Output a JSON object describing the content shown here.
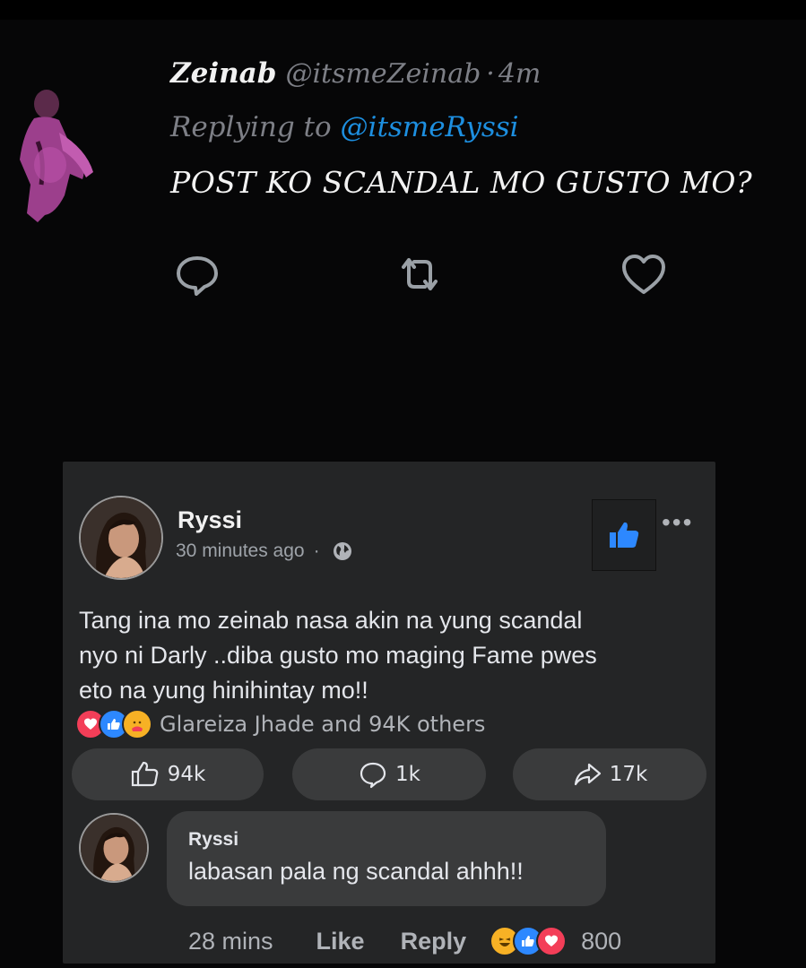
{
  "tweet": {
    "author_name": "Zeinab",
    "author_handle": "@itsmeZeinab",
    "separator": "·",
    "time": "4m",
    "replying_prefix": "Replying to",
    "replying_handle": "@itsmeRyssi",
    "text": "POST KO SCANDAL MO GUSTO MO?",
    "actions": [
      "reply-icon",
      "retweet-icon",
      "like-icon"
    ]
  },
  "post": {
    "author_name": "Ryssi",
    "time": "30 minutes ago",
    "separator": "·",
    "privacy_icon": "globe-icon",
    "more_label": "•••",
    "text_lines": [
      "Tang ina mo zeinab nasa akin na yung scandal",
      "nyo ni Darly ..diba gusto mo maging Fame pwes",
      "eto na yung hinihintay mo!!"
    ],
    "reactions_label": "Glareiza Jhade and 94K others",
    "reaction_icons": [
      "love-icon",
      "like-icon",
      "care-icon"
    ],
    "buttons": {
      "like_count": "94k",
      "comment_count": "1k",
      "share_count": "17k"
    },
    "colors": {
      "accent": "#2d88ff",
      "love": "#f33e58",
      "care": "#f7b125"
    }
  },
  "comment": {
    "author_name": "Ryssi",
    "text": "labasan pala ng scandal ahhh!!",
    "time": "28 mins",
    "like_label": "Like",
    "reply_label": "Reply",
    "reaction_icons": [
      "haha-icon",
      "like-icon",
      "love-icon"
    ],
    "reaction_count": "800"
  }
}
